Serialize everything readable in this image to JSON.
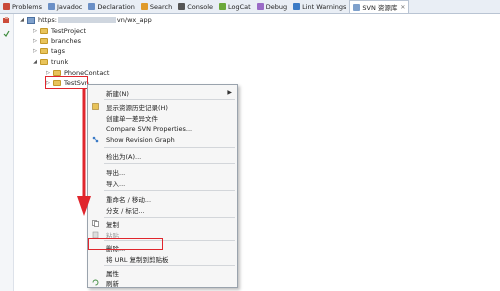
{
  "tabs": [
    {
      "label": "Problems",
      "color": "#c94a3a"
    },
    {
      "label": "Javadoc",
      "color": "#6a8fc6"
    },
    {
      "label": "Declaration",
      "color": "#6a8fc6"
    },
    {
      "label": "Search",
      "color": "#e09a2a"
    },
    {
      "label": "Console",
      "color": "#555555"
    },
    {
      "label": "LogCat",
      "color": "#6ba83a"
    },
    {
      "label": "Debug",
      "color": "#9a6ac6"
    },
    {
      "label": "Lint Warnings",
      "color": "#3a7ac6"
    },
    {
      "label": "SVN 资源库",
      "color": "#7fa1cc",
      "active": true,
      "close": "✕"
    }
  ],
  "tree": {
    "root_prefix": "https:",
    "root_suffix": "vn/wx_app",
    "items": [
      {
        "label": "TestProject"
      },
      {
        "label": "branches"
      },
      {
        "label": "tags"
      },
      {
        "label": "trunk"
      },
      {
        "label": "PhoneContact"
      },
      {
        "label": "TestSvn"
      }
    ]
  },
  "menu": {
    "items": [
      {
        "label": "新建(N)",
        "arrow": "▶"
      },
      {
        "label": "显示资源历史记录(H)"
      },
      {
        "label": "创建单一差异文件"
      },
      {
        "label": "Compare SVN Properties..."
      },
      {
        "label": "Show Revision Graph"
      },
      {
        "label": "检出为(A)..."
      },
      {
        "label": "导出..."
      },
      {
        "label": "导入..."
      },
      {
        "label": "重命名 / 移动..."
      },
      {
        "label": "分支 / 标记..."
      },
      {
        "label": "复制"
      },
      {
        "label": "粘贴",
        "disabled": true
      },
      {
        "label": "删除..."
      },
      {
        "label": "将 URL 复制到剪贴板"
      },
      {
        "label": "属性"
      },
      {
        "label": "刷新"
      }
    ]
  },
  "colors": {
    "highlight": "#e0262d",
    "folder": "#e8c35a"
  }
}
